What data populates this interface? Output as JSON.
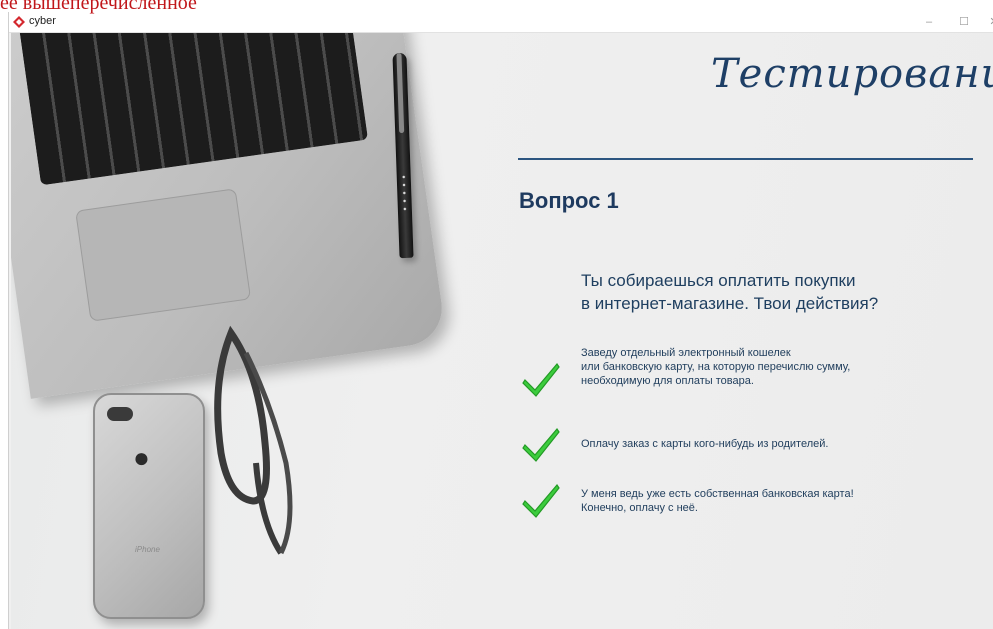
{
  "caption": "ее вышеперечисленное",
  "window": {
    "title": "cyber",
    "minimize_label": "–",
    "maximize_label": "☐",
    "close_label": "✕"
  },
  "header": {
    "title": "Тестирование"
  },
  "question": {
    "number_label": "Вопрос 1",
    "text_lines": [
      "Ты собираешься оплатить покупки",
      "в интернет-магазине. Твои действия?"
    ]
  },
  "answers": [
    {
      "lines": [
        "Заведу отдельный электронный кошелек",
        "или банковскую карту, на которую перечислю сумму,",
        "необходимую для оплаты товара."
      ]
    },
    {
      "lines": [
        "Оплачу заказ с карты кого-нибудь из родителей."
      ]
    },
    {
      "lines": [
        "У меня ведь уже есть собственная банковская карта!",
        "Конечно, оплачу с неё."
      ]
    }
  ],
  "photo": {
    "phone_brand_text": "iPhone"
  },
  "colors": {
    "accent": "#1e3a5f",
    "check": "#38c83a",
    "caption": "#c0161a"
  },
  "icons": {
    "app": "cyber-app-icon",
    "answer_marker": "checkmark-icon"
  }
}
